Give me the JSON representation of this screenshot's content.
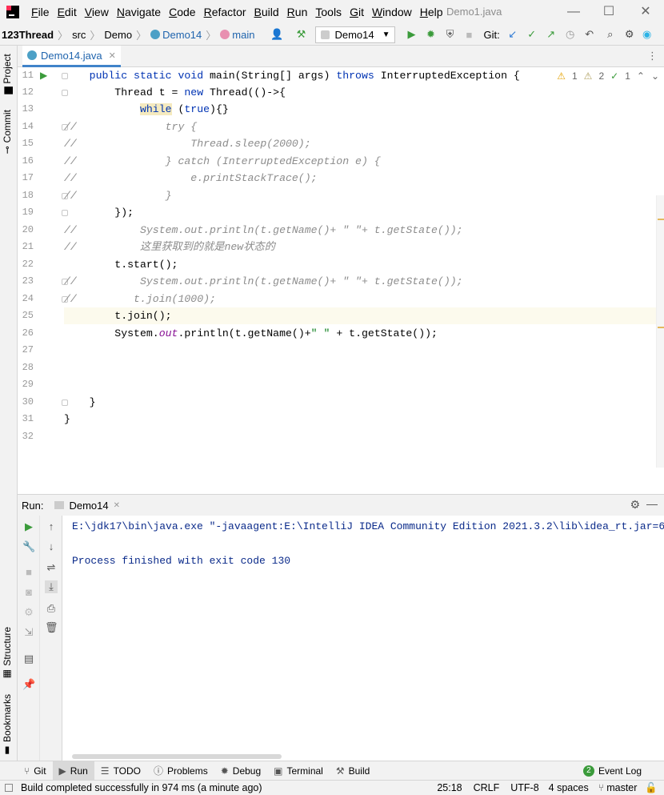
{
  "menubar": {
    "items": [
      "File",
      "Edit",
      "View",
      "Navigate",
      "Code",
      "Refactor",
      "Build",
      "Run",
      "Tools",
      "Git",
      "Window",
      "Help"
    ],
    "window_title": "Demo1.java"
  },
  "toolbar": {
    "project": "123Thread",
    "crumbs": [
      "src",
      "Demo",
      "Demo14",
      "main"
    ],
    "run_config": "Demo14",
    "git_label": "Git:"
  },
  "left_strip": {
    "project": "Project",
    "commit": "Commit",
    "structure": "Structure",
    "bookmarks": "Bookmarks"
  },
  "tabs": [
    {
      "label": "Demo14.java"
    }
  ],
  "inspections": {
    "warnings": "1",
    "weak_warnings": "2",
    "typos": "1"
  },
  "editor": {
    "line_numbers": [
      "11",
      "12",
      "13",
      "14",
      "15",
      "16",
      "17",
      "18",
      "19",
      "20",
      "21",
      "22",
      "23",
      "24",
      "25",
      "26",
      "27",
      "28",
      "29",
      "30",
      "31",
      "32"
    ],
    "current_line": "25"
  },
  "run_panel": {
    "label": "Run:",
    "tab": "Demo14",
    "console": [
      "E:\\jdk17\\bin\\java.exe \"-javaagent:E:\\IntelliJ IDEA Community Edition 2021.3.2\\lib\\idea_rt.jar=6",
      "",
      "Process finished with exit code 130"
    ]
  },
  "bottom_tabs": [
    "Git",
    "Run",
    "TODO",
    "Problems",
    "Debug",
    "Terminal",
    "Build"
  ],
  "event_log": {
    "count": "2",
    "label": "Event Log"
  },
  "status": {
    "message": "Build completed successfully in 974 ms (a minute ago)",
    "position": "25:18",
    "line_sep": "CRLF",
    "encoding": "UTF-8",
    "indent": "4 spaces",
    "branch": "master"
  },
  "colors": {
    "keyword": "#0033b3",
    "comment": "#8c8c8c",
    "accent": "#4083c9",
    "run_green": "#3b9b3b"
  }
}
